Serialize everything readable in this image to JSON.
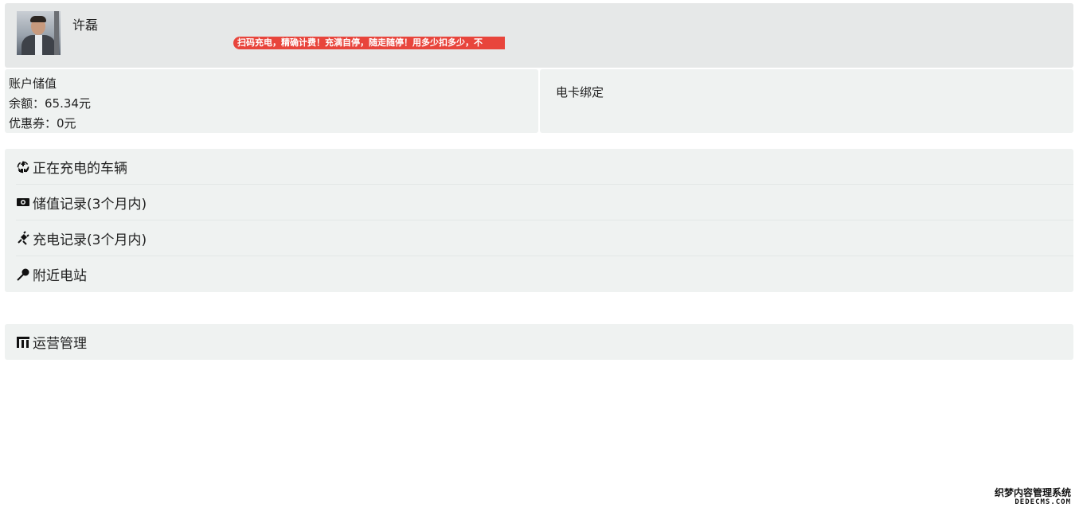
{
  "user": {
    "name": "许磊",
    "notice": "扫码充电，精确计费！充满自停，随走随停！用多少扣多少，不"
  },
  "account": {
    "title": "账户储值",
    "balance": "余额：65.34元",
    "coupon": "优惠券：0元",
    "bind_card": "电卡绑定"
  },
  "menu": {
    "items": [
      {
        "icon": "recycle-icon",
        "label": "正在充电的车辆"
      },
      {
        "icon": "money-icon",
        "label": "储值记录(3个月内)"
      },
      {
        "icon": "plug-icon",
        "label": "充电记录(3个月内)"
      },
      {
        "icon": "pin-icon",
        "label": "附近电站"
      }
    ]
  },
  "ops": {
    "icon": "bar-chart-icon",
    "label": "运营管理"
  },
  "watermark": {
    "line1": "织梦内容管理系统",
    "line2": "DEDECMS.COM"
  },
  "colors": {
    "notice_bg": "#e8453c",
    "panel_bg": "#eff2f1",
    "header_bg": "#e6e8e8"
  }
}
